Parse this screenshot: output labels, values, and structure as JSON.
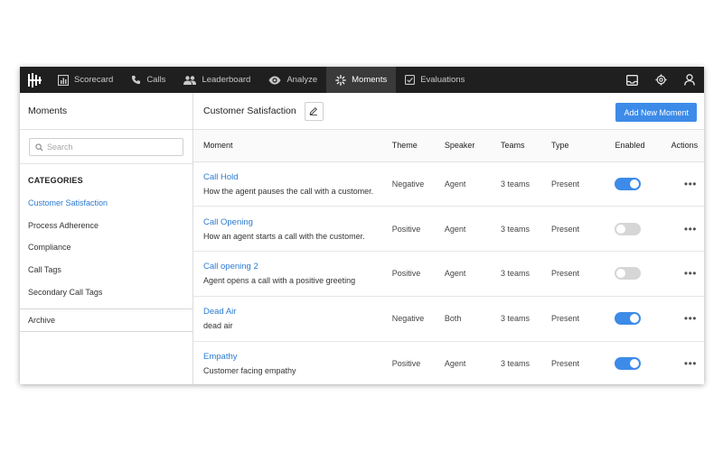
{
  "nav": {
    "items": [
      {
        "label": "Scorecard",
        "icon": "bar-chart-icon"
      },
      {
        "label": "Calls",
        "icon": "phone-icon"
      },
      {
        "label": "Leaderboard",
        "icon": "people-icon"
      },
      {
        "label": "Analyze",
        "icon": "eye-icon"
      },
      {
        "label": "Moments",
        "icon": "burst-icon"
      },
      {
        "label": "Evaluations",
        "icon": "checkbox-icon"
      }
    ],
    "active": "Moments",
    "right_icons": [
      "inbox-icon",
      "gear-icon",
      "user-icon"
    ]
  },
  "sidebar": {
    "title": "Moments",
    "search_placeholder": "Search",
    "categories_title": "CATEGORIES",
    "categories": [
      {
        "label": "Customer Satisfaction",
        "active": true
      },
      {
        "label": "Process Adherence",
        "active": false
      },
      {
        "label": "Compliance",
        "active": false
      },
      {
        "label": "Call Tags",
        "active": false
      },
      {
        "label": "Secondary Call Tags",
        "active": false
      }
    ],
    "archive_label": "Archive"
  },
  "main": {
    "title": "Customer Satisfaction",
    "add_button": "Add New Moment",
    "columns": {
      "moment": "Moment",
      "theme": "Theme",
      "speaker": "Speaker",
      "teams": "Teams",
      "type": "Type",
      "enabled": "Enabled",
      "actions": "Actions"
    },
    "rows": [
      {
        "name": "Call Hold",
        "desc": "How the agent pauses the call with a customer.",
        "theme": "Negative",
        "speaker": "Agent",
        "teams": "3 teams",
        "type": "Present",
        "enabled": true
      },
      {
        "name": "Call Opening",
        "desc": "How an agent starts a call with the customer.",
        "theme": "Positive",
        "speaker": "Agent",
        "teams": "3 teams",
        "type": "Present",
        "enabled": false
      },
      {
        "name": "Call opening 2",
        "desc": "Agent opens a call with a positive greeting",
        "theme": "Positive",
        "speaker": "Agent",
        "teams": "3 teams",
        "type": "Present",
        "enabled": false
      },
      {
        "name": "Dead Air",
        "desc": "dead air",
        "theme": "Negative",
        "speaker": "Both",
        "teams": "3 teams",
        "type": "Present",
        "enabled": true
      },
      {
        "name": "Empathy",
        "desc": "Customer facing empathy",
        "theme": "Positive",
        "speaker": "Agent",
        "teams": "3 teams",
        "type": "Present",
        "enabled": true
      }
    ],
    "row_actions_icon": "more-dots-icon"
  },
  "colors": {
    "accent": "#3d8be8",
    "link": "#2c7bd0",
    "nav_bg": "#1f1f1f",
    "nav_active": "#3a3a3a"
  }
}
